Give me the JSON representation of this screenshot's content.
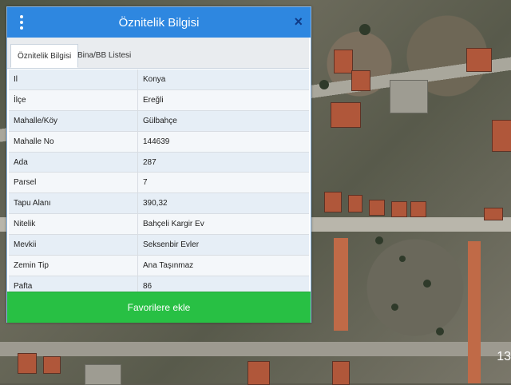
{
  "dialog": {
    "title": "Öznitelik Bilgisi",
    "close_glyph": "×",
    "menu_icon": "kebab-menu-icon",
    "close_icon": "close-icon"
  },
  "tabs": [
    {
      "label": "Öznitelik Bilgisi",
      "active": true
    },
    {
      "label": "Bina/BB Listesi",
      "active": false
    }
  ],
  "attributes": [
    {
      "key": "Il",
      "value": "Konya"
    },
    {
      "key": "İlçe",
      "value": "Ereğli"
    },
    {
      "key": "Mahalle/Köy",
      "value": "Gülbahçe"
    },
    {
      "key": "Mahalle No",
      "value": "144639"
    },
    {
      "key": "Ada",
      "value": "287"
    },
    {
      "key": "Parsel",
      "value": "7"
    },
    {
      "key": "Tapu Alanı",
      "value": "390,32"
    },
    {
      "key": "Nitelik",
      "value": "Bahçeli Kargir Ev"
    },
    {
      "key": "Mevkii",
      "value": "Seksenbir Evler"
    },
    {
      "key": "Zemin Tip",
      "value": "Ana Taşınmaz"
    },
    {
      "key": "Pafta",
      "value": "86"
    }
  ],
  "actions": {
    "favorite_label": "Favorilere ekle"
  },
  "map": {
    "corner_text": "13"
  },
  "colors": {
    "header": "#2e87e0",
    "favorite_button": "#28c044",
    "close_icon": "#0f3a86"
  }
}
